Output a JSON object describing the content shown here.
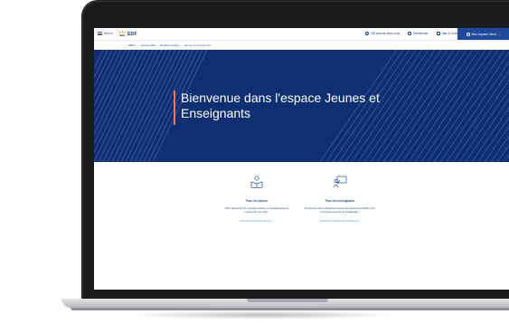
{
  "nav": {
    "menu_label": "Menu",
    "logo_text": "EDF",
    "links": [
      {
        "label": "100 pros de chez vous",
        "icon": "location-icon"
      },
      {
        "label": "Rechercher",
        "icon": "search-icon"
      },
      {
        "label": "Aide & Contact",
        "icon": "mail-icon"
      }
    ],
    "account_label": "Mon espace client"
  },
  "breadcrumb": [
    "EDF.fr",
    "Groupe EDF",
    "Espaces dédiés",
    "Jeunes & enseignants"
  ],
  "hero": {
    "title": "Bienvenue dans l'espace Jeunes et Enseignants",
    "colors": {
      "background": "#0f2f73",
      "accent": "#ff6f4a",
      "lines": "#4d6fb8"
    }
  },
  "cards": [
    {
      "icon": "child-reading-icon",
      "title": "Pour les jeunes",
      "text": "Pour découvrir de manière ludique et pédagogique le monde de l'énergie !",
      "link": "Découvrir l'espace Jeunes"
    },
    {
      "icon": "teacher-board-icon",
      "title": "Pour les enseignants",
      "text": "Retrouvez dès maintenant toutes les ressources EDF pour l'enseignement et la pédagogie !",
      "link": "Découvrir l'espace Enseignants"
    }
  ]
}
